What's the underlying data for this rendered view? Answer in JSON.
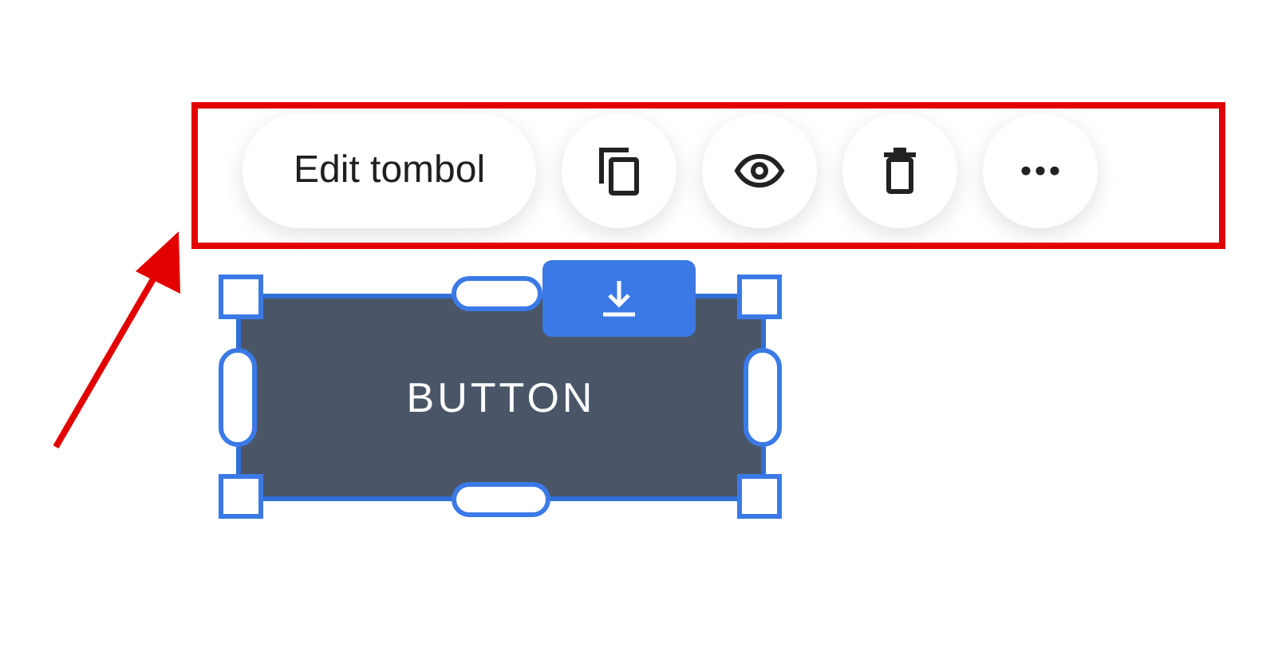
{
  "toolbar": {
    "edit_button": "Edit tombol"
  },
  "canvas_element": {
    "label": "BUTTON",
    "selected": true
  }
}
